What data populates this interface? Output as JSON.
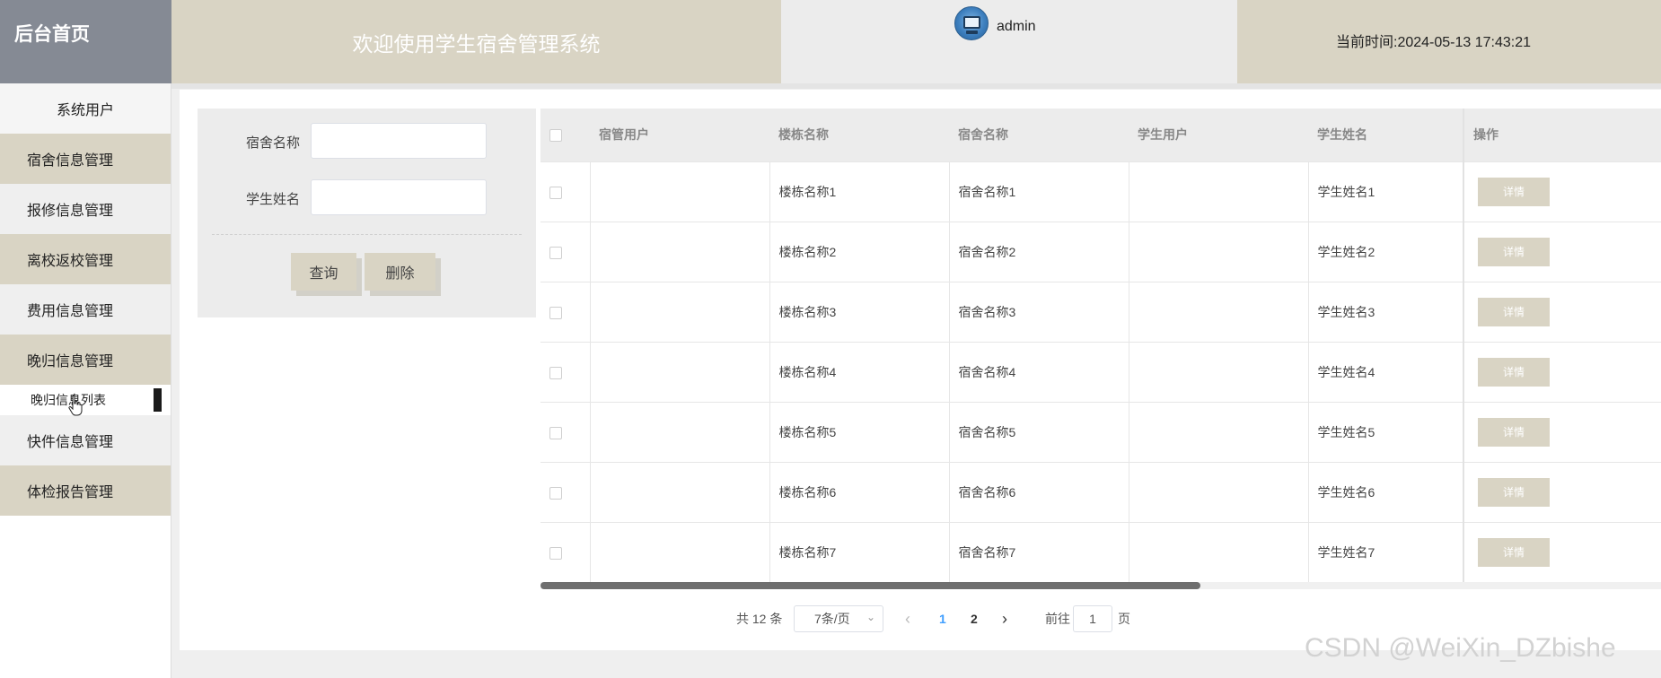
{
  "header": {
    "brand": "后台首页",
    "title": "欢迎使用学生宿舍管理系统",
    "username": "admin",
    "time_label": "当前时间:",
    "time_value": "2024-05-13 17:43:21"
  },
  "sidebar": {
    "items": [
      {
        "label": "系统用户"
      },
      {
        "label": "宿舍信息管理"
      },
      {
        "label": "报修信息管理"
      },
      {
        "label": "离校返校管理"
      },
      {
        "label": "费用信息管理"
      },
      {
        "label": "晚归信息管理"
      },
      {
        "label": "晚归信息列表"
      },
      {
        "label": "快件信息管理"
      },
      {
        "label": "体检报告管理"
      }
    ]
  },
  "search": {
    "dorm_label": "宿舍名称",
    "dorm_value": "",
    "student_label": "学生姓名",
    "student_value": "",
    "query_button": "查询",
    "delete_button": "删除"
  },
  "table": {
    "columns": [
      "宿管用户",
      "楼栋名称",
      "宿舍名称",
      "学生用户",
      "学生姓名",
      "操作"
    ],
    "detail_label": "详情",
    "rows": [
      {
        "manager": "",
        "building": "楼栋名称1",
        "dorm": "宿舍名称1",
        "student_user": "",
        "student_name": "学生姓名1"
      },
      {
        "manager": "",
        "building": "楼栋名称2",
        "dorm": "宿舍名称2",
        "student_user": "",
        "student_name": "学生姓名2"
      },
      {
        "manager": "",
        "building": "楼栋名称3",
        "dorm": "宿舍名称3",
        "student_user": "",
        "student_name": "学生姓名3"
      },
      {
        "manager": "",
        "building": "楼栋名称4",
        "dorm": "宿舍名称4",
        "student_user": "",
        "student_name": "学生姓名4"
      },
      {
        "manager": "",
        "building": "楼栋名称5",
        "dorm": "宿舍名称5",
        "student_user": "",
        "student_name": "学生姓名5"
      },
      {
        "manager": "",
        "building": "楼栋名称6",
        "dorm": "宿舍名称6",
        "student_user": "",
        "student_name": "学生姓名6"
      },
      {
        "manager": "",
        "building": "楼栋名称7",
        "dorm": "宿舍名称7",
        "student_user": "",
        "student_name": "学生姓名7"
      }
    ]
  },
  "pagination": {
    "total": "共 12 条",
    "page_size": "7条/页",
    "prev": "‹",
    "page1": "1",
    "page2": "2",
    "next": "›",
    "goto_label": "前往",
    "goto_value": "1",
    "goto_suffix": "页",
    "active_color": "#409eff"
  },
  "watermark": "CSDN @WeiXin_DZbishe",
  "colors": {
    "accent_tan": "#d9d4c4",
    "brand_gray": "#858a94"
  }
}
